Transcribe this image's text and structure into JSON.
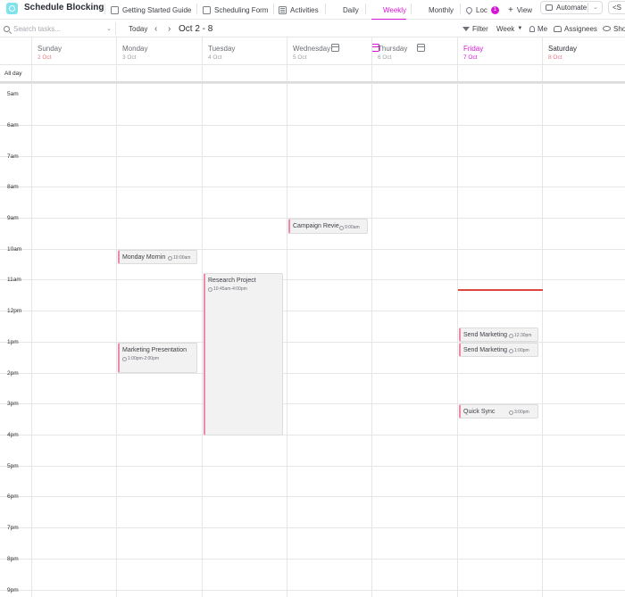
{
  "header": {
    "title": "Schedule Blocking",
    "tabs": [
      {
        "label": "Getting Started Guide",
        "icon": "doc-icon"
      },
      {
        "label": "Scheduling Form",
        "icon": "form-icon"
      },
      {
        "label": "Activities",
        "icon": "list-icon"
      },
      {
        "label": "Daily",
        "icon": "calendar-icon"
      },
      {
        "label": "Weekly",
        "icon": "calendar-icon",
        "active": true
      },
      {
        "label": "Monthly",
        "icon": "calendar-icon"
      },
      {
        "label": "Loc",
        "icon": "map-pin-icon",
        "badge": "1"
      }
    ],
    "add_view_label": "View",
    "automate_label": "Automate",
    "share_label": "S"
  },
  "toolbar": {
    "search_placeholder": "Search tasks...",
    "today_label": "Today",
    "date_range": "Oct 2 - 8",
    "filter_label": "Filter",
    "week_label": "Week",
    "me_label": "Me",
    "assignees_label": "Assignees",
    "show_label": "Show"
  },
  "days": [
    {
      "name": "Sunday",
      "date": "2 Oct",
      "type": "weekend"
    },
    {
      "name": "Monday",
      "date": "3 Oct",
      "type": "weekday"
    },
    {
      "name": "Tuesday",
      "date": "4 Oct",
      "type": "weekday"
    },
    {
      "name": "Wednesday",
      "date": "5 Oct",
      "type": "weekday"
    },
    {
      "name": "Thursday",
      "date": "6 Oct",
      "type": "weekday"
    },
    {
      "name": "Friday",
      "date": "7 Oct",
      "type": "today"
    },
    {
      "name": "Saturday",
      "date": "8 Oct",
      "type": "weekend"
    }
  ],
  "all_day_label": "All day",
  "hours": [
    "5am",
    "6am",
    "7am",
    "8am",
    "9am",
    "10am",
    "11am",
    "12pm",
    "1pm",
    "2pm",
    "3pm",
    "4pm",
    "5pm",
    "6pm",
    "7pm",
    "8pm",
    "9pm"
  ],
  "events": [
    {
      "title": "Campaign Revie",
      "time": "9:00am",
      "day": "Wednesday"
    },
    {
      "title": "Monday Mornin",
      "time": "10:00am",
      "day": "Monday"
    },
    {
      "title": "Research Project",
      "time": "10:45am-4:00pm",
      "day": "Tuesday"
    },
    {
      "title": "Marketing Presentation",
      "time": "1:00pm-2:00pm",
      "day": "Monday"
    },
    {
      "title": "Send Marketing",
      "time": "12:30pm",
      "day": "Friday"
    },
    {
      "title": "Send Marketing",
      "time": "1:00pm",
      "day": "Friday"
    },
    {
      "title": "Quick Sync",
      "time": "3:00pm",
      "day": "Friday"
    }
  ],
  "colors": {
    "accent": "#d517d5",
    "event_border": "#ef8aa6",
    "now_line": "#e0463f",
    "weekend_date": "#e77780"
  }
}
